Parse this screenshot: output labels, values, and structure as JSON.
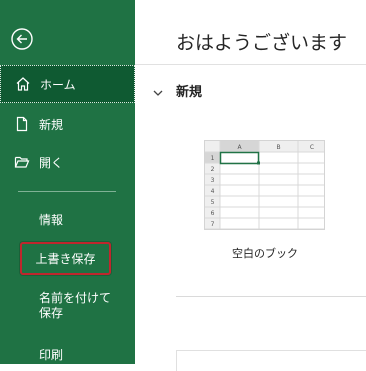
{
  "sidebar": {
    "items": [
      {
        "label": "ホーム"
      },
      {
        "label": "新規"
      },
      {
        "label": "開く"
      },
      {
        "label": "情報"
      },
      {
        "label": "上書き保存"
      },
      {
        "label": "名前を付けて保存"
      },
      {
        "label": "印刷"
      }
    ]
  },
  "main": {
    "greeting": "おはようございます",
    "section_title": "新規",
    "template": {
      "label": "空白のブック",
      "columns": [
        "A",
        "B",
        "C"
      ],
      "rows": [
        "1",
        "2",
        "3",
        "4",
        "5",
        "6",
        "7"
      ]
    }
  },
  "colors": {
    "sidebar_bg": "#1f7244",
    "active_item_bg": "#0f5a32",
    "highlight_border": "#c0262d"
  }
}
